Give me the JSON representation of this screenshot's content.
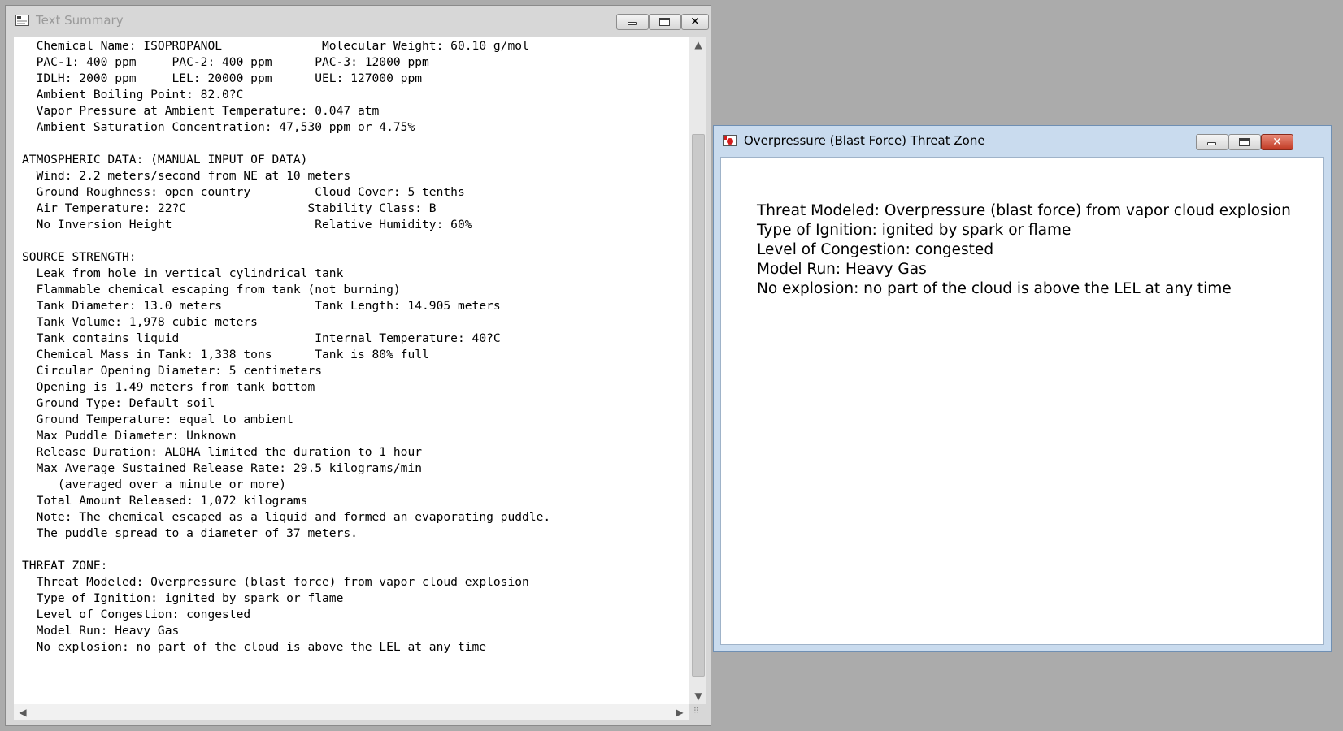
{
  "text_summary": {
    "title": "Text Summary",
    "lines": [
      "  Chemical Name: ISOPROPANOL              Molecular Weight: 60.10 g/mol",
      "  PAC-1: 400 ppm     PAC-2: 400 ppm      PAC-3: 12000 ppm",
      "  IDLH: 2000 ppm     LEL: 20000 ppm      UEL: 127000 ppm",
      "  Ambient Boiling Point: 82.0?C",
      "  Vapor Pressure at Ambient Temperature: 0.047 atm",
      "  Ambient Saturation Concentration: 47,530 ppm or 4.75%",
      "",
      "ATMOSPHERIC DATA: (MANUAL INPUT OF DATA)",
      "  Wind: 2.2 meters/second from NE at 10 meters",
      "  Ground Roughness: open country         Cloud Cover: 5 tenths",
      "  Air Temperature: 22?C                 Stability Class: B",
      "  No Inversion Height                    Relative Humidity: 60%",
      "",
      "SOURCE STRENGTH:",
      "  Leak from hole in vertical cylindrical tank",
      "  Flammable chemical escaping from tank (not burning)",
      "  Tank Diameter: 13.0 meters             Tank Length: 14.905 meters",
      "  Tank Volume: 1,978 cubic meters",
      "  Tank contains liquid                   Internal Temperature: 40?C",
      "  Chemical Mass in Tank: 1,338 tons      Tank is 80% full",
      "  Circular Opening Diameter: 5 centimeters",
      "  Opening is 1.49 meters from tank bottom",
      "  Ground Type: Default soil",
      "  Ground Temperature: equal to ambient",
      "  Max Puddle Diameter: Unknown",
      "  Release Duration: ALOHA limited the duration to 1 hour",
      "  Max Average Sustained Release Rate: 29.5 kilograms/min",
      "     (averaged over a minute or more)",
      "  Total Amount Released: 1,072 kilograms",
      "  Note: The chemical escaped as a liquid and formed an evaporating puddle.",
      "  The puddle spread to a diameter of 37 meters.",
      "",
      "THREAT ZONE:",
      "  Threat Modeled: Overpressure (blast force) from vapor cloud explosion",
      "  Type of Ignition: ignited by spark or flame",
      "  Level of Congestion: congested",
      "  Model Run: Heavy Gas",
      "  No explosion: no part of the cloud is above the LEL at any time"
    ]
  },
  "blast_window": {
    "title": "Overpressure (Blast Force) Threat Zone",
    "lines": [
      "Threat Modeled: Overpressure (blast force) from vapor cloud explosion",
      "Type of Ignition: ignited by spark or flame",
      "Level of Congestion: congested",
      "Model Run: Heavy Gas",
      "No explosion: no part of the cloud is above the LEL at any time"
    ]
  },
  "window_controls": {
    "minimize_icon": "minimize-icon",
    "maximize_icon": "maximize-icon",
    "close_glyph": "✕"
  },
  "colors": {
    "desktop": "#ababab",
    "close_active": "#c13a24",
    "inactive_title": "#9a9a9a"
  }
}
